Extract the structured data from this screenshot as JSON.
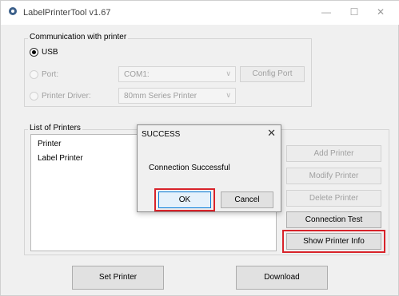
{
  "window": {
    "title": "LabelPrinterTool v1.67",
    "minimize_glyph": "—",
    "maximize_glyph": "☐",
    "close_glyph": "✕"
  },
  "communication": {
    "legend": "Communication with printer",
    "usb_label": "USB",
    "port_label": "Port:",
    "port_value": "COM1:",
    "config_port_label": "Config Port",
    "driver_label": "Printer Driver:",
    "driver_value": "80mm Series Printer"
  },
  "printers": {
    "legend": "List of Printers",
    "header": "Printer",
    "items": [
      "Label Printer"
    ],
    "add_label": "Add Printer",
    "modify_label": "Modify Printer",
    "delete_label": "Delete Printer",
    "connection_test_label": "Connection Test",
    "show_info_label": "Show Printer Info"
  },
  "footer": {
    "set_printer_label": "Set Printer",
    "download_label": "Download"
  },
  "dialog": {
    "title": "SUCCESS",
    "close_glyph": "✕",
    "message": "Connection Successful",
    "ok_label": "OK",
    "cancel_label": "Cancel"
  },
  "colors": {
    "highlight": "#d8232a",
    "focus": "#0078d7"
  },
  "icons": {
    "app": "gear-icon",
    "dropdown": "chevron-down-icon"
  }
}
